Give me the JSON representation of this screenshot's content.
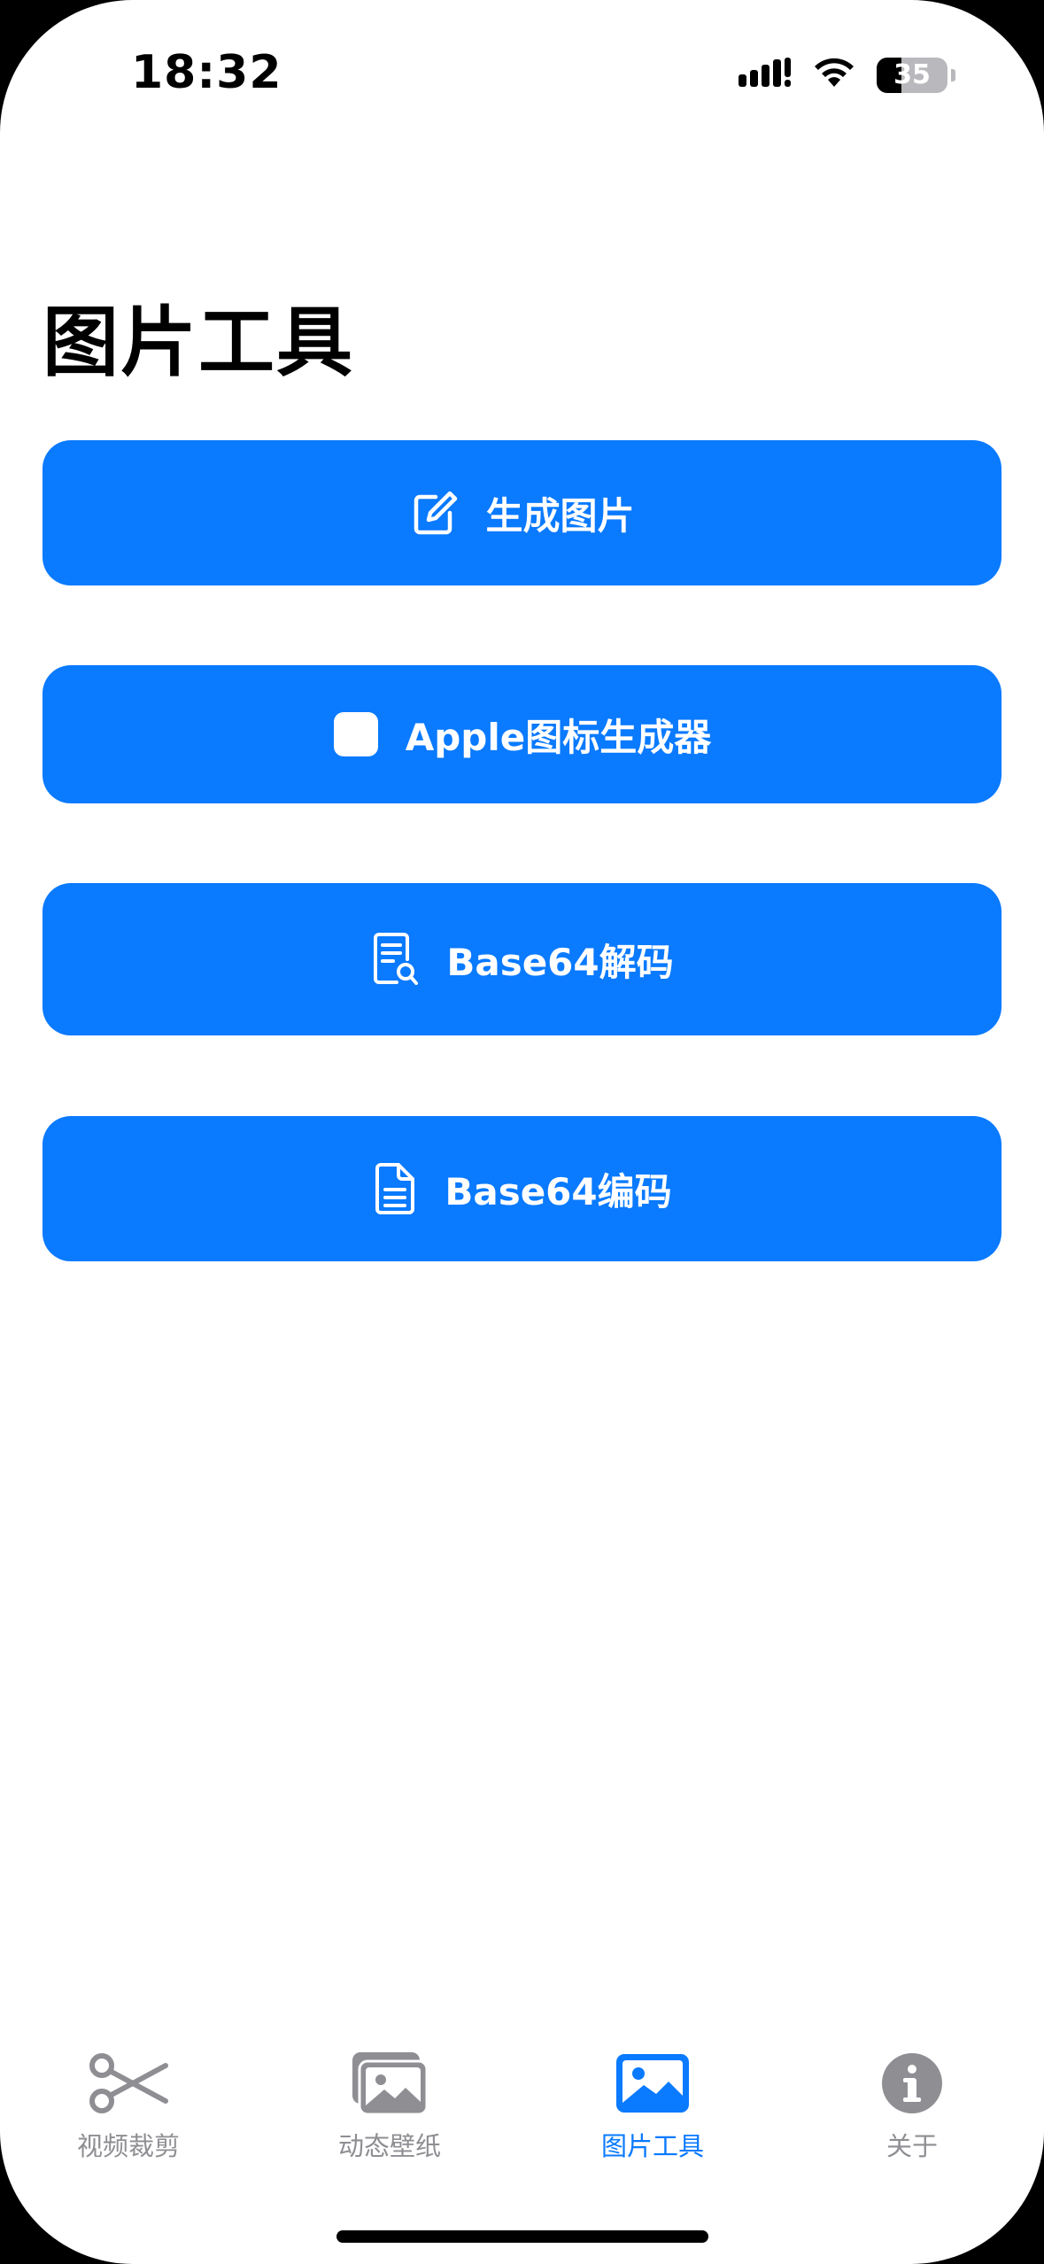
{
  "status_bar": {
    "time": "18:32",
    "battery_level": "35",
    "icons": [
      "cellular-signal-icon",
      "wifi-icon",
      "battery-icon"
    ]
  },
  "page": {
    "title": "图片工具"
  },
  "actions": [
    {
      "label": "生成图片",
      "icon": "square-pencil-icon"
    },
    {
      "label": "Apple图标生成器",
      "icon": "app-square-icon"
    },
    {
      "label": "Base64解码",
      "icon": "document-search-icon"
    },
    {
      "label": "Base64编码",
      "icon": "document-text-icon"
    }
  ],
  "tabbar": {
    "tabs": [
      {
        "label": "视频裁剪",
        "icon": "scissors-icon",
        "active": false
      },
      {
        "label": "动态壁纸",
        "icon": "photo-stack-icon",
        "active": false
      },
      {
        "label": "图片工具",
        "icon": "photo-icon",
        "active": true
      },
      {
        "label": "关于",
        "icon": "info-circle-icon",
        "active": false
      }
    ]
  },
  "colors": {
    "accent": "#0a7aff",
    "inactive_tab": "#8e8e93",
    "background": "#ffffff"
  }
}
